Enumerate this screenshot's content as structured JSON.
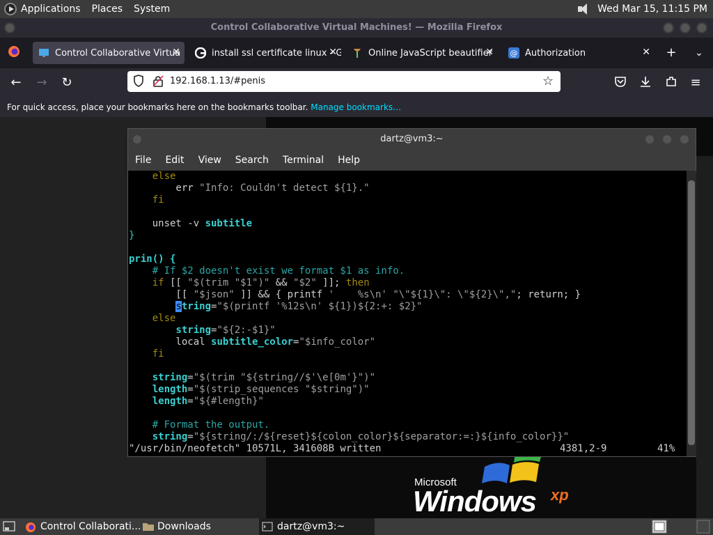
{
  "top_panel": {
    "menus": [
      "Applications",
      "Places",
      "System"
    ],
    "datetime": "Wed Mar 15, 11:15 PM"
  },
  "firefox": {
    "window_title": "Control Collaborative Virtual Machines! — Mozilla Firefox",
    "tabs": [
      {
        "label": "Control Collaborative Virtua",
        "active": true
      },
      {
        "label": "install ssl certificate linux - G",
        "active": false
      },
      {
        "label": "Online JavaScript beautifier",
        "active": false
      },
      {
        "label": "Authorization",
        "active": false
      }
    ],
    "url": "192.168.1.13/#penis",
    "bookmarks_msg": "For quick access, place your bookmarks here on the bookmarks toolbar.",
    "bookmarks_link": "Manage bookmarks…"
  },
  "terminal": {
    "title": "dartz@vm3:~",
    "menu": [
      "File",
      "Edit",
      "View",
      "Search",
      "Terminal",
      "Help"
    ],
    "status_file": "\"/usr/bin/neofetch\" 10571L, 341608B written",
    "status_pos": "4381,2-9",
    "status_pct": "41%"
  },
  "xp_logo": {
    "microsoft": "Microsoft",
    "windows": "Windows",
    "xp": "xp"
  },
  "taskbar": {
    "items": [
      "Control Collaborati...",
      "Downloads",
      "dartz@vm3:~"
    ]
  }
}
